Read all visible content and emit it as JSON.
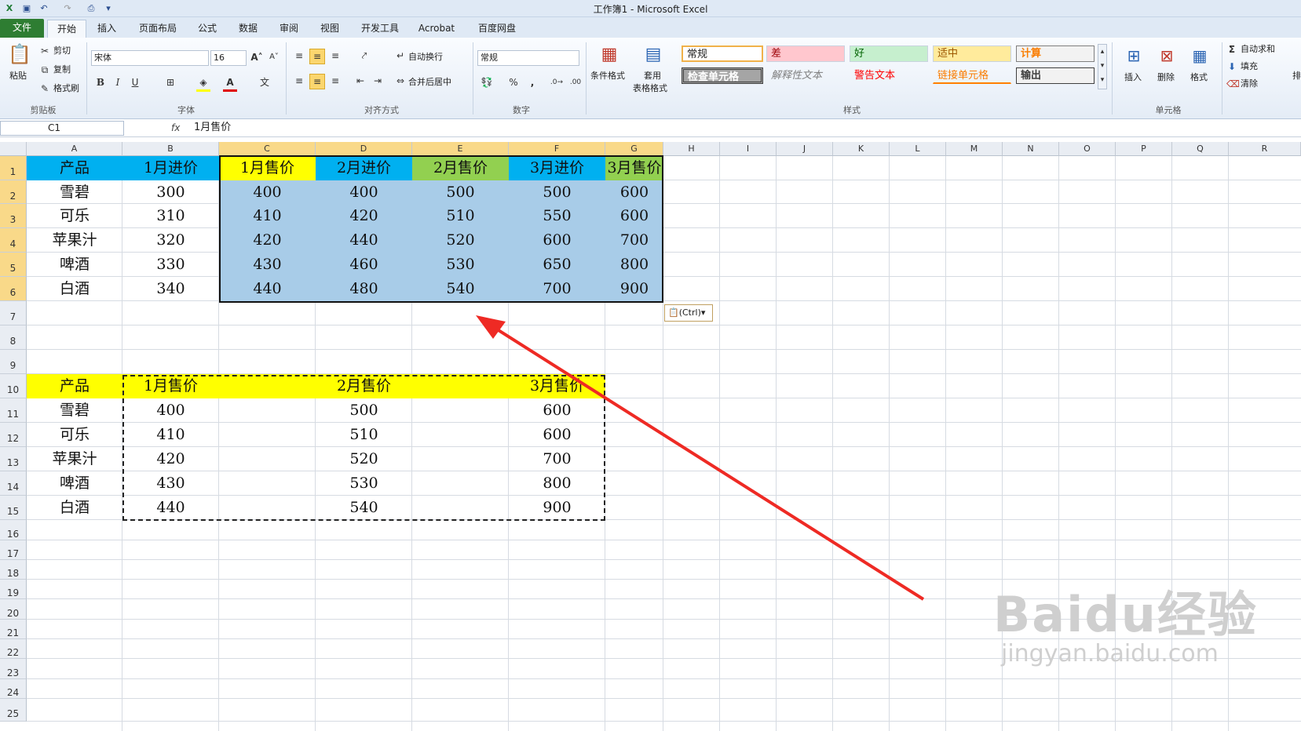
{
  "window": {
    "title": "工作簿1 - Microsoft Excel"
  },
  "tabs": [
    {
      "label": "文件"
    },
    {
      "label": "开始"
    },
    {
      "label": "插入"
    },
    {
      "label": "页面布局"
    },
    {
      "label": "公式"
    },
    {
      "label": "数据"
    },
    {
      "label": "审阅"
    },
    {
      "label": "视图"
    },
    {
      "label": "开发工具"
    },
    {
      "label": "Acrobat"
    },
    {
      "label": "百度网盘"
    }
  ],
  "ribbon": {
    "clipboard": {
      "paste": "粘贴",
      "cut": "剪切",
      "copy": "复制",
      "format_painter": "格式刷",
      "group": "剪贴板"
    },
    "font": {
      "name": "宋体",
      "size": "16",
      "group": "字体",
      "bold": "B",
      "italic": "I",
      "underline": "U"
    },
    "alignment": {
      "wrap": "自动换行",
      "merge": "合并后居中",
      "group": "对齐方式"
    },
    "number": {
      "format": "常规",
      "percent": "%",
      "comma": ",",
      "group": "数字"
    },
    "styles": {
      "cond_format": "条件格式",
      "table_format_1": "套用",
      "table_format_2": "表格格式",
      "group": "样式",
      "items": [
        "常规",
        "差",
        "好",
        "适中",
        "计算",
        "检查单元格",
        "解释性文本",
        "警告文本",
        "链接单元格",
        "输出"
      ]
    },
    "cells": {
      "insert": "插入",
      "delete": "删除",
      "format": "格式",
      "group": "单元格"
    },
    "editing": {
      "autosum": "自动求和",
      "fill": "填充",
      "clear": "清除",
      "sort": "排"
    }
  },
  "formula_bar": {
    "name_box": "C1",
    "fx": "fx",
    "content": "1月售价"
  },
  "columns": [
    "A",
    "B",
    "C",
    "D",
    "E",
    "F",
    "G",
    "H",
    "I",
    "J",
    "K",
    "L",
    "M",
    "N",
    "O",
    "P",
    "Q",
    "R"
  ],
  "rows": [
    "1",
    "2",
    "3",
    "4",
    "5",
    "6",
    "7",
    "8",
    "9",
    "10",
    "11",
    "12",
    "13",
    "14",
    "15",
    "16",
    "17",
    "18",
    "19",
    "20",
    "21",
    "22",
    "23",
    "24",
    "25"
  ],
  "table1": {
    "headers": [
      "产品",
      "1月进价",
      "1月售价",
      "2月进价",
      "2月售价",
      "3月进价",
      "3月售价"
    ],
    "rows": [
      [
        "雪碧",
        "300",
        "400",
        "400",
        "500",
        "500",
        "600"
      ],
      [
        "可乐",
        "310",
        "410",
        "420",
        "510",
        "550",
        "600"
      ],
      [
        "苹果汁",
        "320",
        "420",
        "440",
        "520",
        "600",
        "700"
      ],
      [
        "啤酒",
        "330",
        "430",
        "460",
        "530",
        "650",
        "800"
      ],
      [
        "白酒",
        "340",
        "440",
        "480",
        "540",
        "700",
        "900"
      ]
    ]
  },
  "table2": {
    "headers": [
      "产品",
      "1月售价",
      "2月售价",
      "3月售价"
    ],
    "rows": [
      [
        "雪碧",
        "400",
        "500",
        "600"
      ],
      [
        "可乐",
        "410",
        "510",
        "600"
      ],
      [
        "苹果汁",
        "420",
        "520",
        "700"
      ],
      [
        "啤酒",
        "430",
        "530",
        "800"
      ],
      [
        "白酒",
        "440",
        "540",
        "900"
      ]
    ]
  },
  "paste_options": {
    "label": "(Ctrl)"
  },
  "watermark": {
    "text1": "Baidu经验",
    "text2": "jingyan.baidu.com"
  },
  "colors": {
    "header_blue": "#00b0f0",
    "header_yellow": "#ffff00",
    "header_green": "#92d050",
    "selection_fill": "#a8cce8",
    "arrow": "#ee2a24"
  }
}
